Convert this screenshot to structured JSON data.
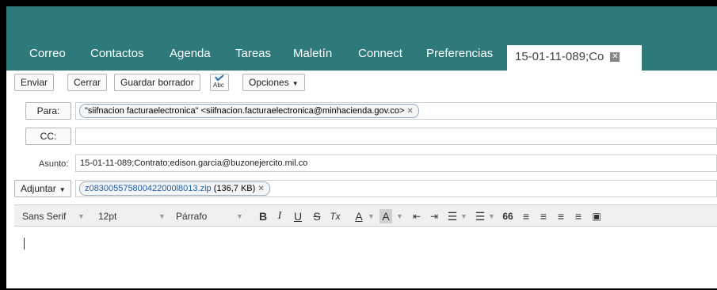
{
  "nav": {
    "tabs": [
      "Correo",
      "Contactos",
      "Agenda",
      "Tareas",
      "Maletín",
      "Connect",
      "Preferencias"
    ],
    "active_tab": "15-01-11-089;Co",
    "active_close_symbol": "✕"
  },
  "compose_toolbar": {
    "send": "Enviar",
    "close": "Cerrar",
    "save_draft": "Guardar borrador",
    "spellcheck_label": "Abc",
    "options": "Opciones"
  },
  "to": {
    "button": "Para:",
    "recipient": "\"siifnacion facturaelectronica\" <siifnacion.facturaelectronica@minhacienda.gov.co>"
  },
  "cc": {
    "button": "CC:"
  },
  "subject": {
    "label": "Asunto:",
    "value": "15-01-11-089;Contrato;edison.garcia@buzonejercito.mil.co"
  },
  "attach": {
    "button": "Adjuntar",
    "file_name": "z083005575800422000l8013.zip",
    "file_size": "(136,7 KB)"
  },
  "editor_toolbar": {
    "font_family": "Sans Serif",
    "font_size": "12pt",
    "format": "Párrafo",
    "bold": "B",
    "italic": "I",
    "underline": "U",
    "strikethrough": "S",
    "clear_format": "Tx",
    "font_color": "A",
    "highlight": "A",
    "quote": "66"
  },
  "icons": {
    "spellcheck": "spellcheck-icon",
    "dropdown": "chevron-down-icon"
  },
  "colors": {
    "header_bg": "#2e7a7b",
    "text": "#222222"
  }
}
